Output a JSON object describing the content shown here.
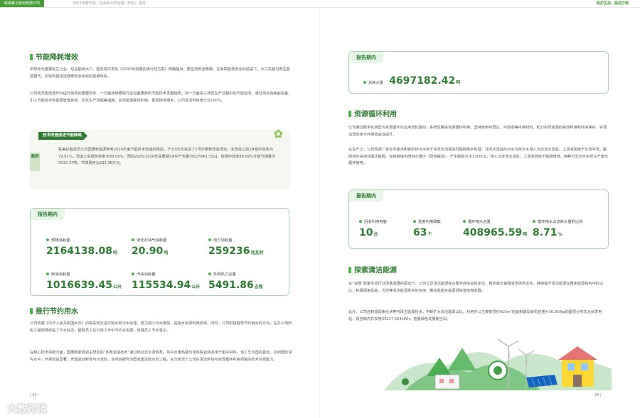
{
  "header": {
    "company": "联美量子股份有限公司",
    "report": "2025年度环境、社会和公司治理（ESG）报告",
    "slogan": "联护生态，美润万物"
  },
  "left": {
    "section1_title": "节能降耗增效",
    "p1": "供热作为重要民生行业，也是能耗大户。国务院印发的《2030年前碳达峰行动方案》明确指出，要坚持安全降碳，在保障能源安全的前提下，大力实施可再生能源替代，加快构建清洁低碳安全高效的能源体系。",
    "p2": "公司将节能改造作为提升能效的重要抓手，一方面持续跟踪行业设备更新和节能技术发展趋势，另一方面深入排查生产过程中的节能空间，通过淘汰高耗能设备、引入节能技术和能源管理系统、优化生产流程等措施，实现能源高效利用。截至报告期末，公司清洁供热率已达100%。",
    "case_title": "技术改造促进节能降耗",
    "case_flag": "案例",
    "case_body": "联美控股成员公司国惠新能源参考2024年度节能技术改造的经验，于2025年完成了1号炉更新改造项目，未改造之前1#锅炉效率为79.81%，改造之后锅炉效率为88.09%。预估2025-2026年采暖期1#炉产热量为627843.31GJ，按锅炉效率88.09%计算节煤量为5532.37吨，节煤费用为232.36万元。",
    "box_title": "报告期内",
    "stats": [
      {
        "label": "燃煤消耗量",
        "value": "2164138.08",
        "unit": "吨"
      },
      {
        "label": "液化石油气消耗量",
        "value": "20.90",
        "unit": "吨"
      },
      {
        "label": "电力消耗量",
        "value": "259236",
        "unit": "兆瓦时"
      },
      {
        "label": "柴油消耗量",
        "value": "1016639.45",
        "unit": "公升"
      },
      {
        "label": "汽油消耗量",
        "value": "115534.94",
        "unit": "公升"
      },
      {
        "label": "外购热力总量",
        "value": "5491.86",
        "unit": "吉焦"
      }
    ],
    "section2_title": "推行节约用水",
    "p3": "公司依据《中华人民共和国水法》的相关规定进行取水和污水处理，努力减少污水排放，提高水资源利用效率。同时，公司积极倡导节约用水的行为，在办公场所和工程现场张贴了节水标志，鼓励员工在日常工作中节约水资源，增强员工节水意识。",
    "p4": "在核心技术突破方面，国惠新能源自主研发的“热泵自适技术”通过热动式水源热泵，将中水废热能与余热联合回收用于集中供热，该工艺与国内首创、达到国际领先水平，环保效益显著，凭借其创新性与示范性，该项目被列为国家建设部示范工程，充分体现了公司在清洁供热与资源循环利用领域的技术引领能力。",
    "page": "33"
  },
  "right": {
    "box1_title": "报告期内",
    "total_water_label": "总耗水量",
    "total_water_value": "4697182.42",
    "total_water_unit": "吨",
    "section3_title": "资源循环利用",
    "p5": "公司通过数字化转型与资源循环化应用双轮驱动，系统性推进资源循环利用，坚持使用可再生、可回收等环保材料，助力实现资源的高效利用和环境保护，实现运营效率与环境效益双提升。",
    "p6": "在生产上，公司热源厂将化学废水和锅炉排污水用于冲洗灰渣或进行脱硫排水处理：冲洗灰渣后的污水为除灰水排入沉淀池沉淀后，上清液回用于灰渣冲洗；脱硫排水采用双碱法脱硫，在脱硫塔内喷淋水循环（配有碱液），产生脱硫污水1300t/d，排入沉淀池沉淀后，上清液回用于脱硫喷淋，两种方式均可实现生产废水循环使用。",
    "box2_title": "报告期内",
    "stats2": [
      {
        "label": "回收利用电脑",
        "value": "10",
        "unit": "台"
      },
      {
        "label": "重复利用硒鼓",
        "value": "63",
        "unit": "个"
      },
      {
        "label": "循环用水总量",
        "value": "408965.59",
        "unit": "吨"
      },
      {
        "label": "循环用水占总耗水量的比例",
        "value": "8.71",
        "unit": "%"
      }
    ],
    "section4_title": "探索清洁能源",
    "p7": "在“双碳”政策引领行业改革发展的驱动下，公司立足清洁能源综合服务商的总体定位，稳步做大做强清洁供热业务，持续提升清洁能源在整体能源结构中的占比，积极探索氢能、光伏等清洁能源技术的应用，推动氢能在能源领域落地和实践。",
    "p8": "此外，公司还积极探索光伏等可再生能源技术，不断扩大清洁能源占比。利用办公主楼楼顶约910m²的面积建设装机容量为30.8kWp的屋顶分布式光伏发电站，报告期内共发电34217.564kWh，拓展绿色发展新空间。",
    "page": "34"
  },
  "watermark": "大数跨境",
  "colors": {
    "accent": "#2e7d32",
    "light": "#e8f5e9",
    "brand": "#4a9d3a"
  }
}
